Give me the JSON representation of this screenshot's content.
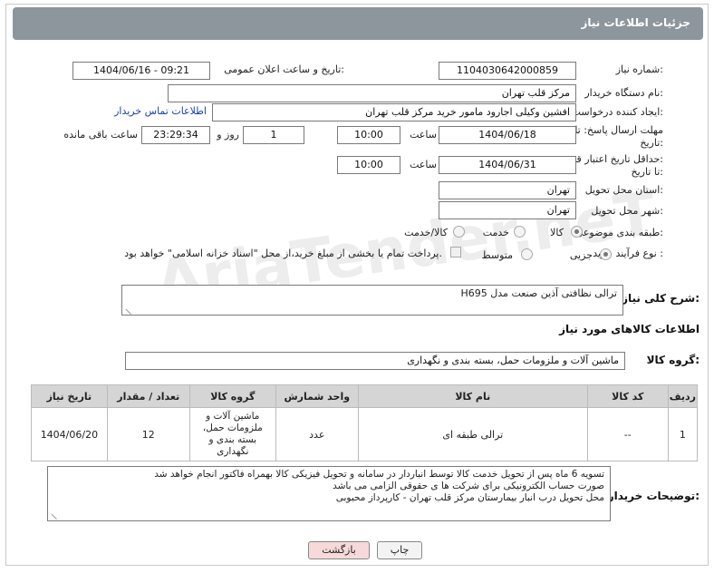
{
  "header": {
    "title": "جزئیات اطلاعات نیاز"
  },
  "fields": {
    "need_number_label": "شماره نیاز:",
    "need_number": "1104030642000859",
    "announce_label": "تاریخ و ساعت اعلان عمومی:",
    "announce_value": "1404/06/16 - 09:21",
    "buyer_org_label": "نام دستگاه خریدار:",
    "buyer_org": "مرکز قلب تهران",
    "requester_label": "ایجاد کننده درخواست:",
    "requester": "افشین وکیلی اجارود مامور خرید مرکز قلب تهران",
    "contact_link": "اطلاعات تماس خریدار",
    "deadline_label_1": "مهلت ارسال پاسخ: تا",
    "deadline_label_2": "تاریخ:",
    "deadline_date": "1404/06/18",
    "time_label": "ساعت",
    "deadline_time": "10:00",
    "days": "1",
    "days_label": "روز و",
    "remaining": "23:29:34",
    "remaining_label": "ساعت باقی مانده",
    "min_validity_label_1": "حداقل تاریخ اعتبار قیمت:",
    "min_validity_label_2": "تا تاریخ:",
    "validity_date": "1404/06/31",
    "validity_time": "10:00",
    "province_label": "استان محل تحویل:",
    "province": "تهران",
    "city_label": "شهر محل تحویل:",
    "city": "تهران",
    "category_label": "طبقه بندی موضوعی:",
    "category_options": [
      "کالا",
      "خدمت",
      "کالا/خدمت"
    ],
    "process_label": "نوع فرآیند خرید :",
    "process_options": [
      "جزیی",
      "متوسط"
    ],
    "payment_note": "پرداخت تمام یا بخشی از مبلغ خرید،از محل \"اسناد خزانه اسلامی\" خواهد بود."
  },
  "description": {
    "label": "شرح کلی نیاز:",
    "text": "ترالی نظافتی آذین صنعت مدل H695"
  },
  "goods_section": {
    "title": "اطلاعات کالاهای مورد نیاز",
    "group_label": "گروه کالا:",
    "group_value": "ماشین آلات و ملزومات حمل، بسته بندی و نگهداری"
  },
  "table": {
    "headers": [
      "ردیف",
      "کد کالا",
      "نام کالا",
      "واحد شمارش",
      "گروه کالا",
      "تعداد / مقدار",
      "تاریخ نیاز"
    ],
    "rows": [
      {
        "row": "1",
        "code": "--",
        "name": "ترالی طبقه ای",
        "unit": "عدد",
        "group": "ماشین آلات و ملزومات حمل، بسته بندی و نگهداری",
        "qty": "12",
        "date": "1404/06/20"
      }
    ]
  },
  "buyer_notes": {
    "label": "توضیحات خریدار:",
    "line1": "تسویه 6 ماه پس از تحویل خدمت کالا توسط انباردار در سامانه و تحویل فیزیکی کالا بهمراه فاکتور انجام خواهد شد",
    "line2": "صورت حساب الکترونیکی برای شرکت ها ی حقوقی الزامی می باشد",
    "line3": "محل تحویل درب انبار بیمارستان مرکز قلب تهران - کارپرداز محبوبی"
  },
  "buttons": {
    "print": "چاپ",
    "back": "بازگشت"
  },
  "watermark": "AriaTender.neT",
  "colors": {
    "header_bg": "#8e969d",
    "back_button_bg": "#f7d9d9",
    "link": "#1a3fa8"
  }
}
